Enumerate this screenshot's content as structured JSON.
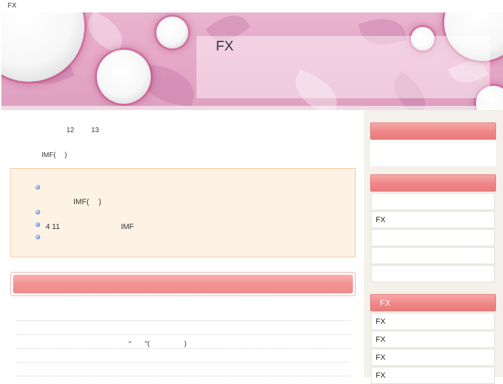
{
  "topbar": {
    "label": "FX"
  },
  "header": {
    "site_title": "FX"
  },
  "main": {
    "date_month": "12",
    "date_day": "13",
    "subtitle": "IMF(　 )",
    "info_items": [
      {
        "text": ""
      },
      {
        "text": "IMF(　 )"
      },
      {
        "text": ""
      },
      {
        "text": "4 11　　　　　　　　IMF"
      },
      {
        "text": ""
      }
    ],
    "section_bar_label": "",
    "list_rows": [
      {
        "text": ""
      },
      {
        "text": ""
      },
      {
        "text": "“　　\"(　　　　　)"
      },
      {
        "text": ""
      },
      {
        "text": ""
      }
    ]
  },
  "sidebar": {
    "section1_title": "",
    "section2_title": "",
    "section2_items": [
      "",
      "FX",
      "",
      "",
      ""
    ],
    "section3_title": "FX",
    "section3_items": [
      "FX",
      "FX",
      "FX",
      "FX"
    ]
  },
  "colors": {
    "header_pink": "#e7a9c8",
    "accent_red": "#ef8787",
    "info_bg": "#fdf2e4",
    "info_border": "#f5c99a",
    "sidebar_bg": "#f4f0ea"
  }
}
